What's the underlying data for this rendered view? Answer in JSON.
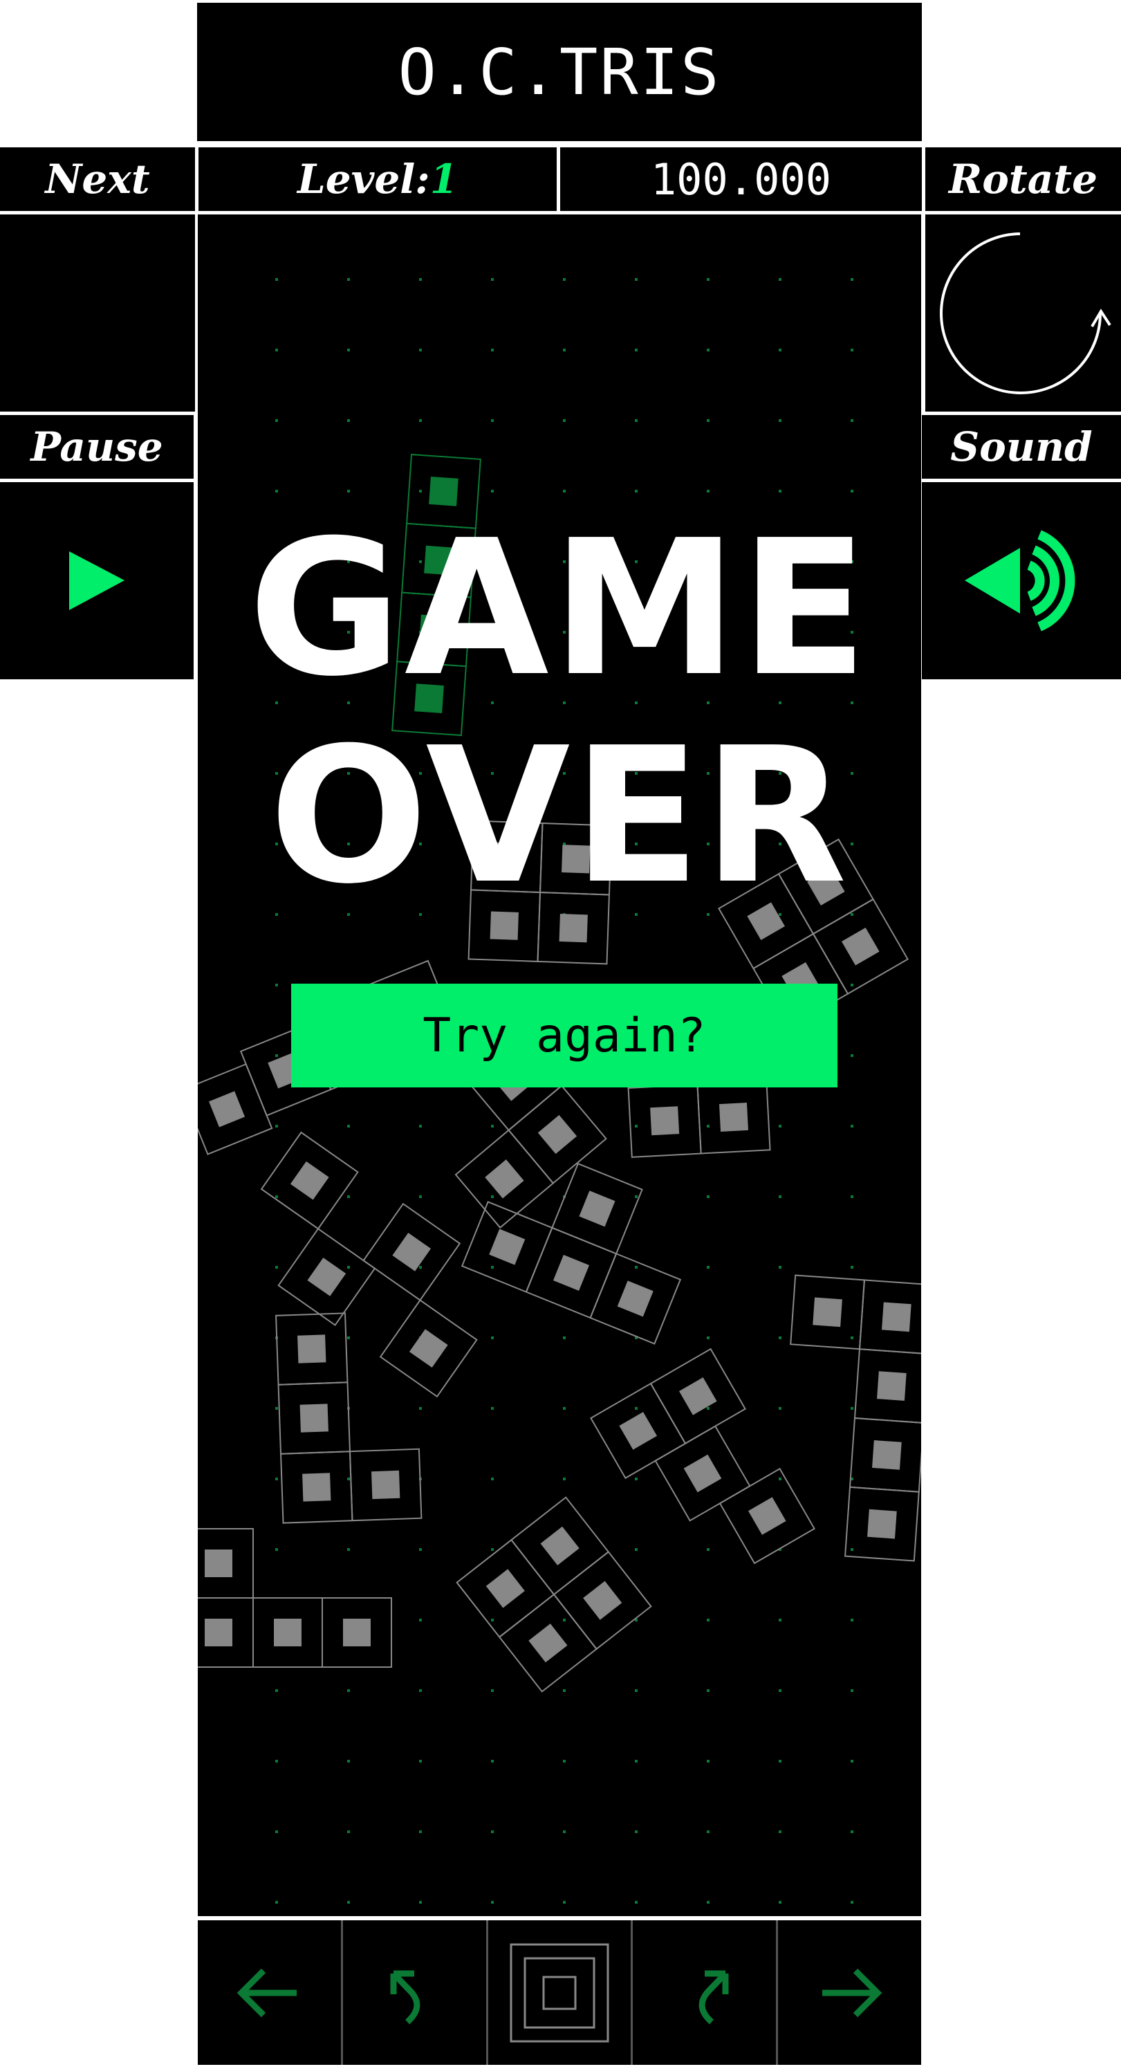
{
  "header": {
    "title": "O.C.TRIS",
    "next_label": "Next",
    "level_label": "Level:",
    "level_value": "1",
    "score": "100.000",
    "rotate_label": "Rotate"
  },
  "side": {
    "pause_label": "Pause",
    "sound_label": "Sound"
  },
  "overlay": {
    "line1": "GAME",
    "line2": "OVER",
    "button_label": "Try again?"
  },
  "controls": [
    {
      "icon": "arrow-left-icon"
    },
    {
      "icon": "rotate-right-icon"
    },
    {
      "icon": "drop-icon"
    },
    {
      "icon": "rotate-left-icon"
    },
    {
      "icon": "arrow-right-icon"
    }
  ],
  "colors": {
    "accent": "#00ee6a",
    "background": "#000000",
    "frame": "#ffffff"
  }
}
